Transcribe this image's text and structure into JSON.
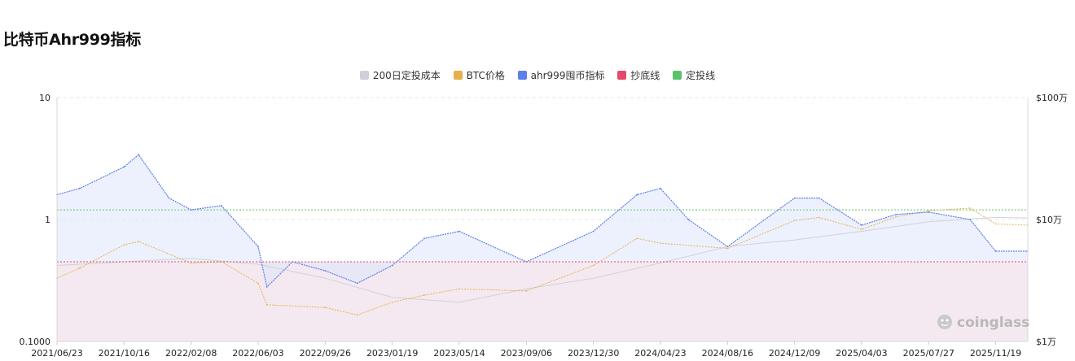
{
  "page": {
    "title": "比特币Ahr999指标"
  },
  "watermark": "coinglass",
  "chart_data": {
    "type": "line",
    "title": "比特币Ahr999指标",
    "y_left": {
      "scale": "log",
      "range": [
        0.1,
        10
      ],
      "ticks": [
        "10",
        "1",
        "0.1000"
      ]
    },
    "y_right": {
      "scale": "log",
      "range": [
        10000,
        1000000
      ],
      "ticks": [
        "$100万",
        "$10万",
        "$1万"
      ]
    },
    "x_tick_labels": [
      "2021/06/23",
      "2021/10/16",
      "2022/02/08",
      "2022/06/03",
      "2022/09/26",
      "2023/01/19",
      "2023/05/14",
      "2023/09/06",
      "2023/12/30",
      "2024/04/23",
      "2024/08/16",
      "2024/12/09",
      "2025/04/03",
      "2025/07/27",
      "2025/11/19"
    ],
    "x_range": [
      "2021/06/23",
      "2026/01/13"
    ],
    "legend_position": "top-center",
    "grid": true,
    "thresholds": {
      "bottom_line": 0.45,
      "dca_line": 1.2
    },
    "series": [
      {
        "name": "200日定投成本",
        "color": "#cfd1d8",
        "axis": "right",
        "x": [
          "2021/06/23",
          "2021/10/16",
          "2022/02/08",
          "2022/06/03",
          "2022/09/26",
          "2023/01/19",
          "2023/05/14",
          "2023/09/06",
          "2023/12/30",
          "2024/04/23",
          "2024/08/16",
          "2024/12/09",
          "2025/04/03",
          "2025/07/27",
          "2025/11/19",
          "2026/01/13"
        ],
        "values": [
          42000,
          45000,
          48000,
          43000,
          33000,
          23000,
          21000,
          27000,
          33000,
          44000,
          60000,
          68000,
          80000,
          96000,
          104000,
          103000
        ]
      },
      {
        "name": "BTC价格",
        "color": "#e6b04e",
        "axis": "right",
        "x": [
          "2021/06/23",
          "2021/08/01",
          "2021/10/16",
          "2021/11/10",
          "2022/02/08",
          "2022/04/01",
          "2022/06/03",
          "2022/06/18",
          "2022/09/26",
          "2022/11/20",
          "2023/01/19",
          "2023/03/15",
          "2023/05/14",
          "2023/09/06",
          "2023/12/30",
          "2024/03/14",
          "2024/04/23",
          "2024/08/16",
          "2024/12/09",
          "2025/01/20",
          "2025/04/03",
          "2025/06/01",
          "2025/07/27",
          "2025/10/06",
          "2025/11/19",
          "2026/01/13"
        ],
        "values": [
          33000,
          40000,
          62000,
          66000,
          44000,
          45000,
          30000,
          20000,
          19000,
          16500,
          21000,
          24000,
          27000,
          26000,
          42000,
          70000,
          64000,
          58000,
          98000,
          104000,
          83000,
          105000,
          118000,
          124000,
          92000,
          90000
        ]
      },
      {
        "name": "ahr999囤币指标",
        "color": "#5b80e8",
        "axis": "left",
        "x": [
          "2021/06/23",
          "2021/08/01",
          "2021/10/16",
          "2021/11/10",
          "2022/01/01",
          "2022/02/08",
          "2022/04/01",
          "2022/06/03",
          "2022/06/18",
          "2022/08/01",
          "2022/09/26",
          "2022/11/20",
          "2023/01/19",
          "2023/03/15",
          "2023/05/14",
          "2023/09/06",
          "2023/12/30",
          "2024/03/14",
          "2024/04/23",
          "2024/06/10",
          "2024/08/16",
          "2024/12/09",
          "2025/01/20",
          "2025/04/03",
          "2025/06/01",
          "2025/07/27",
          "2025/10/06",
          "2025/11/19",
          "2026/01/13"
        ],
        "values": [
          1.6,
          1.8,
          2.7,
          3.4,
          1.5,
          1.2,
          1.3,
          0.6,
          0.28,
          0.45,
          0.38,
          0.3,
          0.42,
          0.7,
          0.8,
          0.45,
          0.8,
          1.6,
          1.8,
          1.0,
          0.6,
          1.5,
          1.5,
          0.9,
          1.1,
          1.15,
          1.0,
          0.55,
          0.55
        ]
      },
      {
        "name": "抄底线",
        "color": "#e34a6a",
        "axis": "left",
        "x": [
          "2021/06/23",
          "2026/01/13"
        ],
        "values": [
          0.45,
          0.45
        ]
      },
      {
        "name": "定投线",
        "color": "#5cc26a",
        "axis": "left",
        "x": [
          "2021/06/23",
          "2026/01/13"
        ],
        "values": [
          1.2,
          1.2
        ]
      }
    ]
  }
}
